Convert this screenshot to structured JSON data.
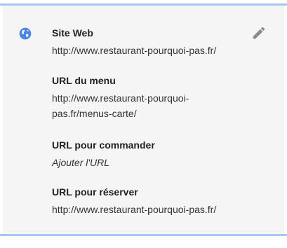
{
  "website": {
    "label": "Site Web",
    "value": "http://www.restaurant-pourquoi-pas.fr/"
  },
  "menu": {
    "label": "URL du menu",
    "value_line1": "http://www.restaurant-pourquoi-",
    "value_line2": "pas.fr/menus-carte/"
  },
  "order": {
    "label": "URL pour commander",
    "value": "Ajouter l'URL"
  },
  "reserve": {
    "label": "URL pour réserver",
    "value": "http://www.restaurant-pourquoi-pas.fr/"
  },
  "icons": {
    "globe": "globe-icon",
    "edit": "pencil-icon"
  },
  "colors": {
    "accent": "#4a86e8",
    "frame": "#a6c8f7",
    "card_bg": "#f5f5f5"
  }
}
